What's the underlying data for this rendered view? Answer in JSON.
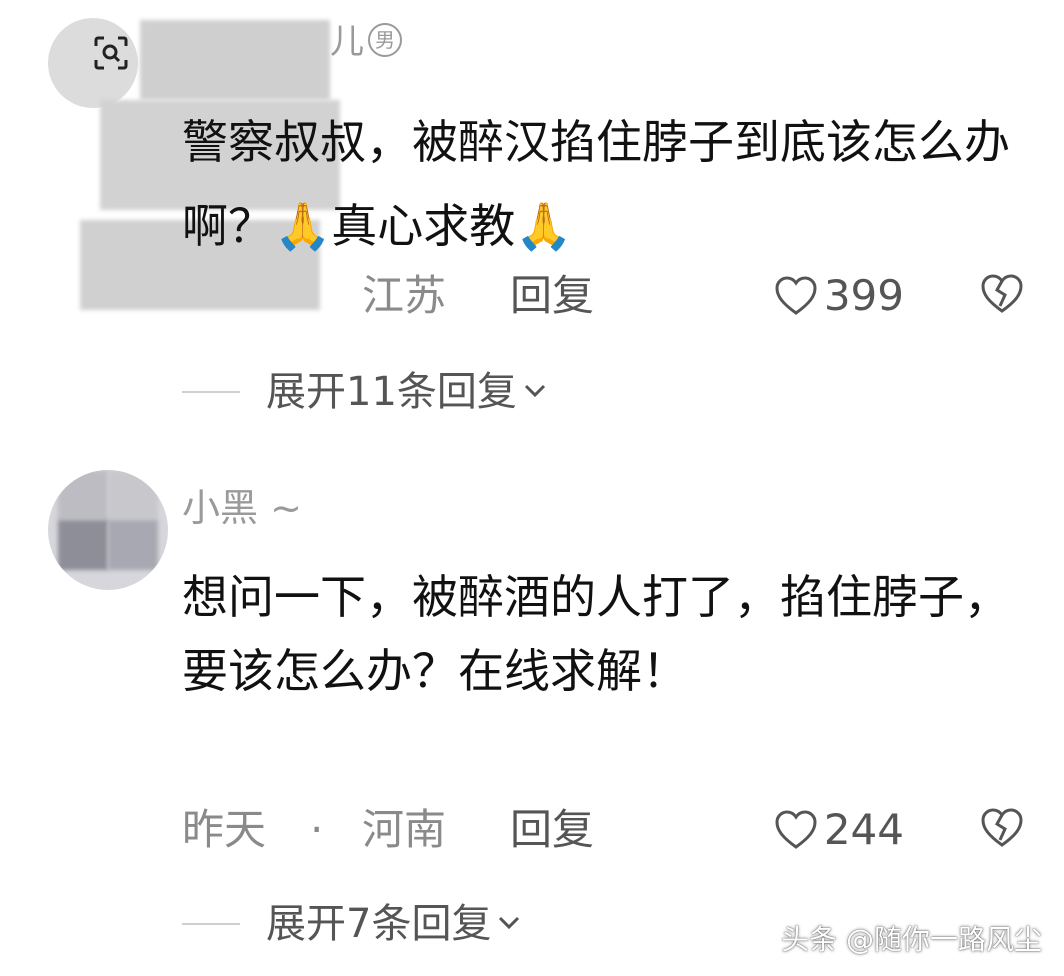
{
  "comment1": {
    "username_visible": "儿",
    "gender_badge": "男",
    "text": "警察叔叔，被醉汉掐住脖子到底该怎么办啊？",
    "text_suffix": "真心求教",
    "emoji": "🙏",
    "location": "江苏",
    "reply_label": "回复",
    "like_count": "399",
    "expand_label": "展开11条回复"
  },
  "comment2": {
    "username": "小黑 ~",
    "text": "想问一下，被醉酒的人打了，掐住脖子，要该怎么办？在线求解！",
    "time": "昨天",
    "separator": "·",
    "location": "河南",
    "reply_label": "回复",
    "like_count": "244",
    "expand_label": "展开7条回复"
  },
  "watermark": "头条 @随你一路风尘",
  "colors": {
    "text_primary": "#111111",
    "text_secondary": "#8a8a8a",
    "text_action": "#555555",
    "blur": "#cfcfcf"
  }
}
